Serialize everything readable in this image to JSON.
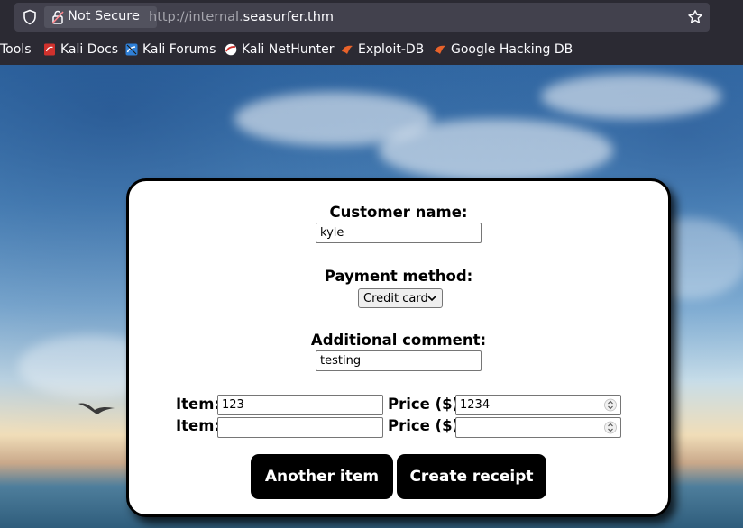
{
  "browser": {
    "security_label": "Not Secure",
    "url_prefix": "http://internal.",
    "url_domain": "seasurfer.thm"
  },
  "bookmarks": [
    {
      "label": "Tools",
      "icon": "none"
    },
    {
      "label": "Kali Docs",
      "icon": "kali-docs-icon"
    },
    {
      "label": "Kali Forums",
      "icon": "kali-forums-icon"
    },
    {
      "label": "Kali NetHunter",
      "icon": "kali-nethunter-icon"
    },
    {
      "label": "Exploit-DB",
      "icon": "exploit-db-icon"
    },
    {
      "label": "Google Hacking DB",
      "icon": "ghdb-icon"
    }
  ],
  "form": {
    "customer_label": "Customer name:",
    "customer_value": "kyle",
    "payment_label": "Payment method:",
    "payment_selected": "Credit card",
    "comment_label": "Additional comment:",
    "comment_value": "testing",
    "items": [
      {
        "item_label": "Item:",
        "item_value": "123",
        "price_label": "Price ($):",
        "price_value": "1234"
      },
      {
        "item_label": "Item:",
        "item_value": "",
        "price_label": "Price ($):",
        "price_value": ""
      }
    ],
    "another_item_label": "Another item",
    "create_receipt_label": "Create receipt"
  },
  "colors": {
    "chrome_bg": "#2b2a33",
    "urlbar_bg": "#42414d",
    "button_bg": "#000000",
    "card_bg": "#ffffff"
  }
}
